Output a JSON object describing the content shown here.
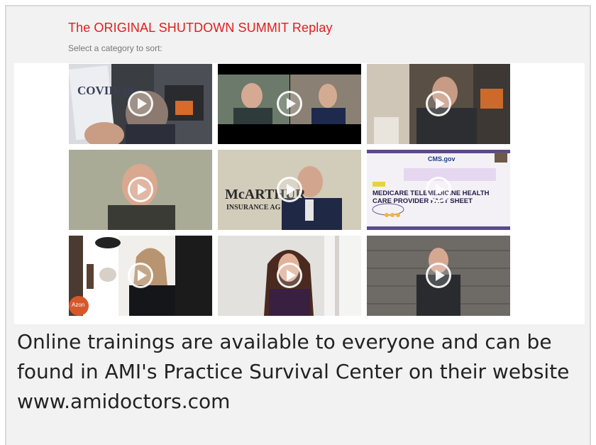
{
  "header": {
    "title": "The ORIGINAL SHUTDOWN SUMMIT Replay",
    "subtitle": "Select a category to sort:"
  },
  "videos": [
    {
      "overlay": "COVID-19"
    },
    {
      "overlay": ""
    },
    {
      "overlay": ""
    },
    {
      "overlay": ""
    },
    {
      "overlay": "McARTHUR",
      "overlay2": "INSURANCE AG"
    },
    {
      "overlay": "CMS.gov",
      "overlay2": "MEDICARE TELEMEDICINE HEALTH",
      "overlay3": "CARE PROVIDER FACT SHEET"
    },
    {
      "overlay": "Azon"
    },
    {
      "overlay": ""
    },
    {
      "overlay": ""
    }
  ],
  "caption": "Online trainings are available to everyone and can be found in AMI's Practice Survival Center on their website www.amidoctors.com",
  "colors": {
    "title": "#e01e1e",
    "panel": "#f2f2f2"
  },
  "icons": {
    "play": "play-circle-icon"
  }
}
